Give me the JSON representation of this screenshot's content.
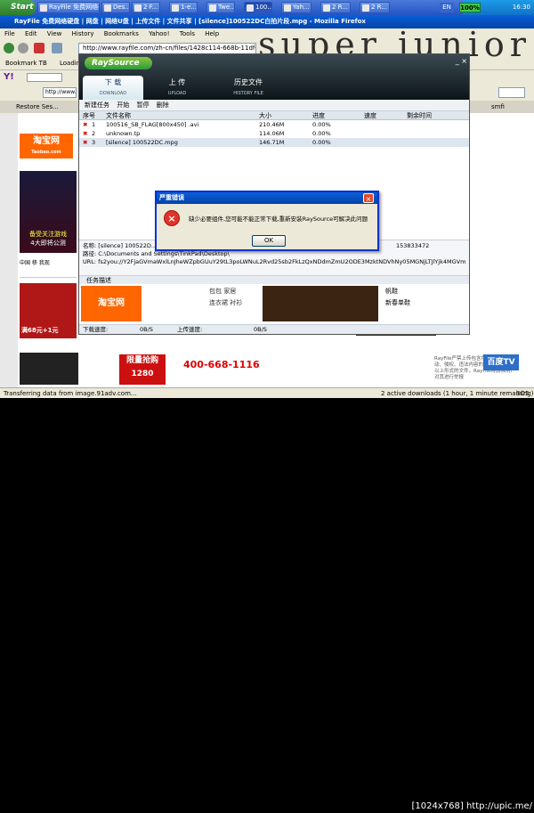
{
  "taskbar": {
    "start": "Start",
    "buttons": [
      "RayFile 免费网络硬盘 | 网盘 | 网络U盘 | 2 F...",
      "Des...",
      "2 F...",
      "1-e...",
      "Twe...",
      "100...",
      "Yah...",
      "2 R...",
      "2 R..."
    ],
    "lang": "EN",
    "battery": "100%",
    "clock": "16:30"
  },
  "firefox": {
    "title": "RayFile 免费网络硬盘 | 网盘 | 网络U盘 | 上传文件 | 文件共享 | [silence]100522DC白拍片段.mpg - Mozilla Firefox",
    "menu": [
      "File",
      "Edit",
      "View",
      "History",
      "Bookmarks",
      "Yahoo!",
      "Tools",
      "Help"
    ],
    "url1": "http://www.rayfile.com/zh-cn/files/1428c114-668b-11df-b25e-0015c55db73d/",
    "bookmark_tab": "Bookmark TB",
    "loading": "Loading...",
    "yahoo": "Y!",
    "url2": "http://www.r",
    "tab_restore": "Restore Ses...",
    "tab_smfb": "smfi",
    "status": "Transferring data from image.91adv.com...",
    "status_right": "2 active downloads (1 hour, 1 minute remaining)",
    "status_zoom": "SO5"
  },
  "bigword": "super junior",
  "raysource": {
    "logo": "RaySource",
    "tabs": [
      {
        "label": "下 载",
        "sub": "DOWNLOAD"
      },
      {
        "label": "上 传",
        "sub": "UPLOAD"
      },
      {
        "label": "历史文件",
        "sub": "HISTORY FILE"
      }
    ],
    "controls": "_ ×",
    "toolbar": [
      "新建任务",
      "开始",
      "暂停",
      "删除"
    ],
    "columns": [
      "序号",
      "文件名称",
      "大小",
      "进度",
      "速度",
      "剩余时间"
    ],
    "rows": [
      {
        "no": "1",
        "name": "100516_SB_FLAG[800x450] .avi",
        "size": "210.46M",
        "progress": "0.00%"
      },
      {
        "no": "2",
        "name": "unknown.tp",
        "size": "114.06M",
        "progress": "0.00%"
      },
      {
        "no": "3",
        "name": "[silence] 100522DC.mpg",
        "size": "146.71M",
        "progress": "0.00%"
      }
    ],
    "info": {
      "name_label": "名称:",
      "name_value": "[silence] 100522D...",
      "name_size": "153833472",
      "path_label": "路径:",
      "path_value": "C:\\Documents and Settings\\TinkPad\\Desktop\\",
      "url_label": "URL:",
      "url_value": "fs2you://Y2FjaGVmaWxlLnJheWZpbGUuY29tL3poLWNuL2Rvd25sb2FkLzQxNDdmZmU2ODE3MzktNDVhNy05MGNjLTJlYjk4MGVmLyU1Q3NpbGVuY2U..."
    },
    "desc_tab": "任务描述",
    "speed_down": "下载速度:",
    "speed_down_val": "0B/S",
    "speed_up": "上传速度:",
    "speed_up_val": "0B/S"
  },
  "dialog": {
    "title": "严重错误",
    "close": "×",
    "icon": "×",
    "message": "缺少必要组件,您可能不能正常下载,重新安装RaySource可解决此问题",
    "ok": "OK"
  },
  "ads": {
    "taobao": "淘宝网",
    "taobao_sub": "Taobao.com",
    "game_text": "备受关注游戏",
    "game_text2": "4大即将公测",
    "china": "中国 移 我现",
    "dress_price": "满68元+1元",
    "mid_words": [
      "包包",
      "家居",
      "连衣裙",
      "衬衫",
      "帆鞋",
      "新春单鞋"
    ],
    "limit": "限量抢购",
    "limit_num": "1280",
    "tel": "400-668-1116",
    "rayfile_text": "RayFile严禁上传包含色情、暴力、反动、侵权、违法内容的文件。如发现有以上形式的文件，RayFile将删除用户对其进行举报",
    "baidu": "百度TV",
    "caption": "[1024x768] http://upic.me/"
  },
  "colors": {
    "xp_blue": "#0a5fd8",
    "error_red": "#e0332a",
    "taobao_orange": "#ff6600"
  }
}
